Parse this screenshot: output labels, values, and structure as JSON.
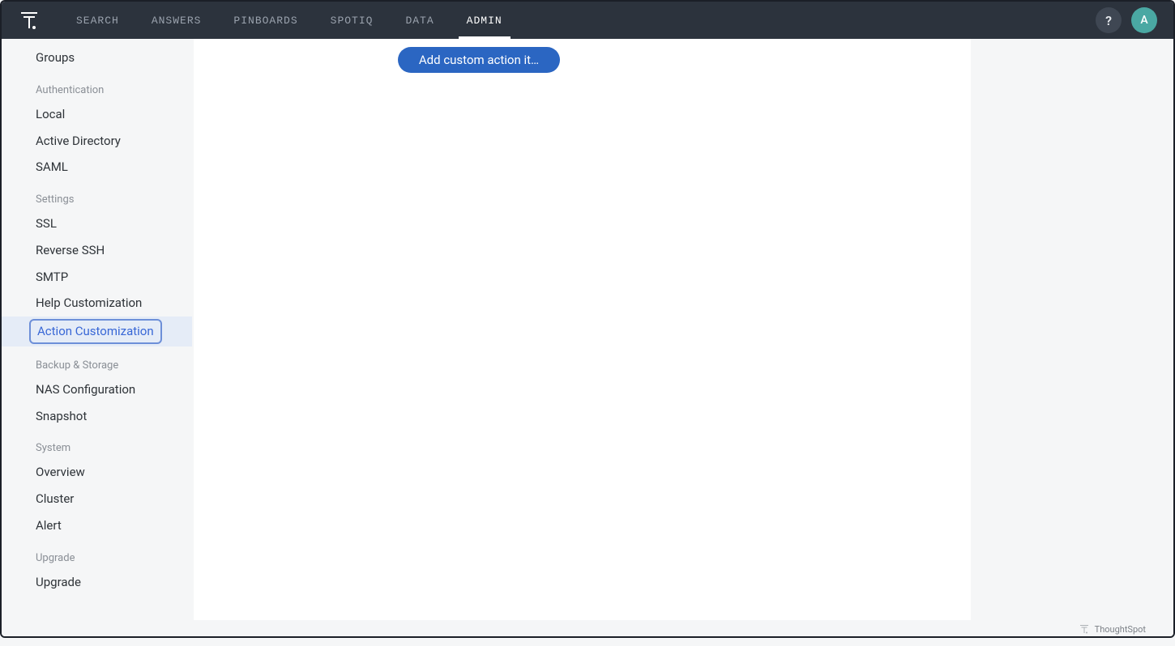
{
  "nav": {
    "items": [
      "SEARCH",
      "ANSWERS",
      "PINBOARDS",
      "SPOTIQ",
      "DATA",
      "ADMIN"
    ],
    "active_index": 5,
    "help_label": "?",
    "avatar_initial": "A"
  },
  "sidebar": {
    "top_items": [
      "Groups"
    ],
    "sections": [
      {
        "label": "Authentication",
        "items": [
          "Local",
          "Active Directory",
          "SAML"
        ]
      },
      {
        "label": "Settings",
        "items": [
          "SSL",
          "Reverse SSH",
          "SMTP",
          "Help Customization",
          "Action Customization"
        ],
        "selected_index": 4
      },
      {
        "label": "Backup & Storage",
        "items": [
          "NAS Configuration",
          "Snapshot"
        ]
      },
      {
        "label": "System",
        "items": [
          "Overview",
          "Cluster",
          "Alert"
        ]
      },
      {
        "label": "Upgrade",
        "items": [
          "Upgrade"
        ]
      }
    ]
  },
  "main": {
    "add_button_label": "Add custom action it…"
  },
  "footer": {
    "brand": "ThoughtSpot"
  }
}
